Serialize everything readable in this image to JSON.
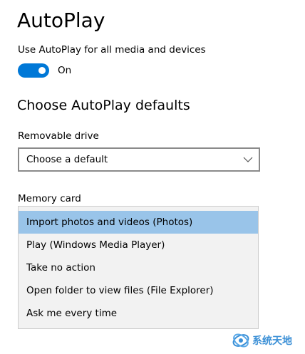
{
  "page": {
    "title": "AutoPlay"
  },
  "autoplay_toggle": {
    "label": "Use AutoPlay for all media and devices",
    "state": "On",
    "on": true
  },
  "defaults": {
    "section_title": "Choose AutoPlay defaults",
    "removable_drive": {
      "label": "Removable drive",
      "selected": "Choose a default"
    },
    "memory_card": {
      "label": "Memory card",
      "options": [
        "Import photos and videos (Photos)",
        "Play (Windows Media Player)",
        "Take no action",
        "Open folder to view files (File Explorer)",
        "Ask me every time"
      ],
      "highlighted": "Import photos and videos (Photos)"
    }
  },
  "watermark": {
    "text": "系统天地"
  },
  "colors": {
    "accent": "#0078d7",
    "highlight": "#99c4e9",
    "dropdown_bg": "#f2f2f2"
  },
  "icons": {
    "dropdown": "chevron-down-icon",
    "watermark": "logo-icon"
  }
}
